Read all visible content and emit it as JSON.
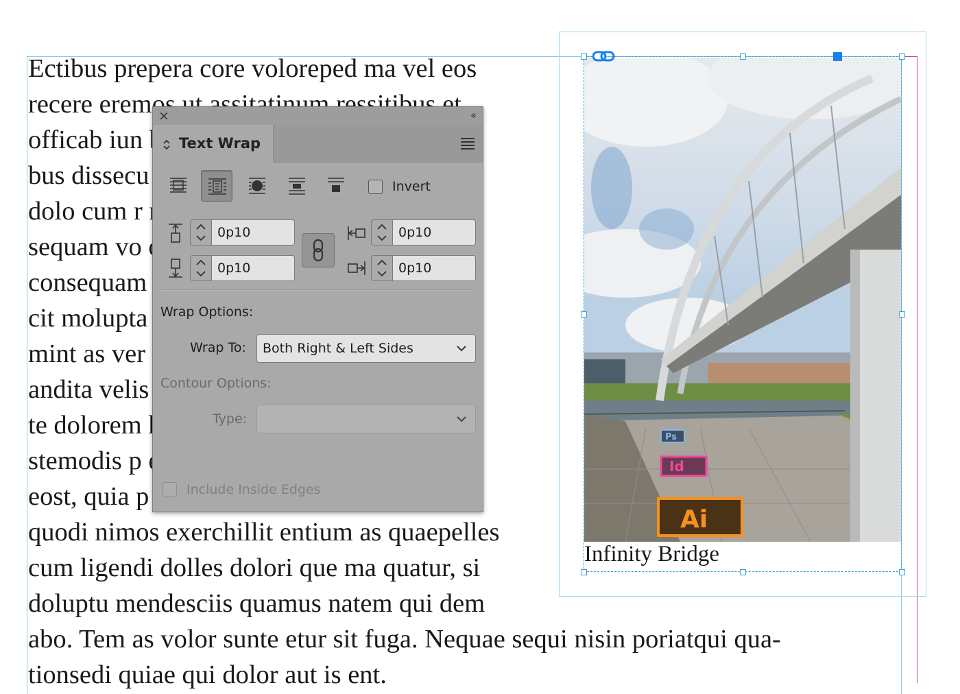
{
  "document": {
    "body_lines": [
      "Ectibus prepera core voloreped ma vel eos",
      "recere eremos ut assitatinum ressitibus et",
      "officab iun                                               bori-",
      "bus dissecu                                               iis",
      "dolo cum r                                               n-",
      "sequam vo                                               ore",
      "consequam                                               uidus-",
      "cit molupta                                               repe",
      "mint as ver                                               labor",
      "andita velis                                               etur,",
      "te dolorem                                               hi de-",
      "stemodis p                                               estis",
      "eost, quia p                                               m qui",
      "quodi nimos exerchillit entium as quaepelles",
      "cum ligendi dolles dolori que ma quatur, si",
      "doluptu mendesciis quamus natem qui dem",
      "abo. Tem as volor sunte etur sit fuga. Nequae sequi nisin poriatqui qua-",
      "tionsedi quiae qui dolor aut is ent."
    ],
    "image_caption": "Infinity Bridge"
  },
  "panel": {
    "title": "Text Wrap",
    "close_glyph": "×",
    "collapse_glyph": "‹‹",
    "invert_label": "Invert",
    "invert_checked": false,
    "wrap_modes": [
      "no-text-wrap",
      "wrap-around-bounding-box",
      "wrap-around-object-shape",
      "jump-object",
      "jump-to-next-column"
    ],
    "selected_wrap_mode": "wrap-around-bounding-box",
    "offsets": {
      "top": "0p10",
      "bottom": "0p10",
      "left": "0p10",
      "right": "0p10"
    },
    "wrap_options_label": "Wrap Options:",
    "wrap_to_label": "Wrap To:",
    "wrap_to_value": "Both Right & Left Sides",
    "contour_options_label": "Contour Options:",
    "type_label": "Type:",
    "type_value": "",
    "include_inside_edges_label": "Include Inside Edges",
    "include_inside_edges_checked": false
  },
  "photo_overlays": {
    "ps_label": "Ps",
    "id_label": "Id",
    "ai_label": "Ai"
  },
  "colors": {
    "frame_blue": "#3b9fd8",
    "margin_magenta": "#c040b0",
    "panel_bg": "#a9a9a9",
    "handle_selected": "#1a7ff0"
  }
}
